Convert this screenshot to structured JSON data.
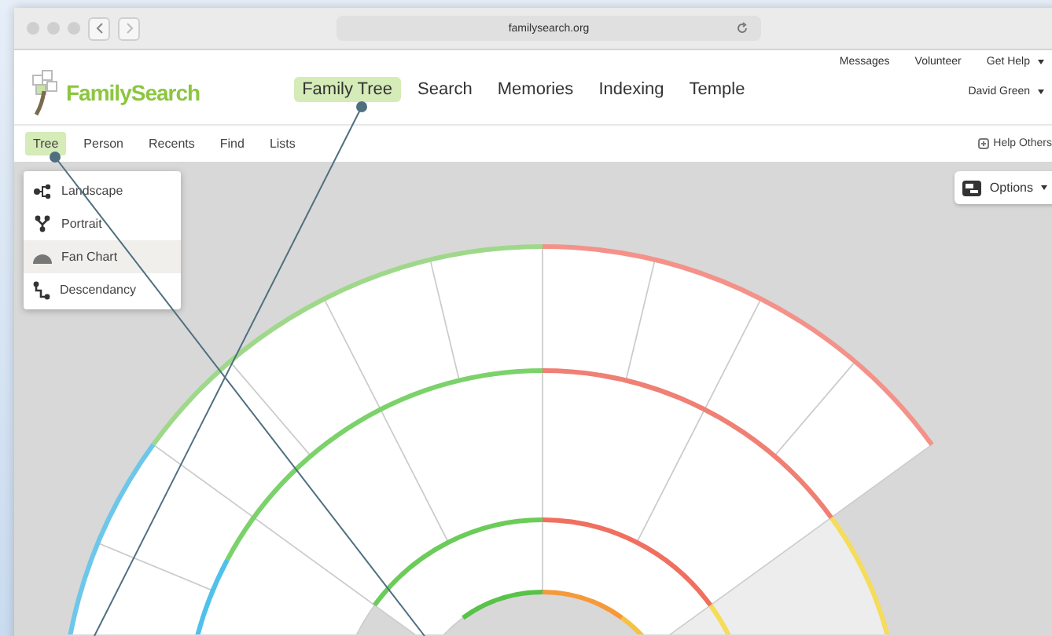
{
  "browser": {
    "address": "familysearch.org"
  },
  "header": {
    "logo": "FamilySearch",
    "top_links": [
      "Messages",
      "Volunteer",
      "Get Help"
    ],
    "user": "David Green",
    "nav": [
      {
        "label": "Family Tree",
        "selected": true
      },
      {
        "label": "Search",
        "selected": false
      },
      {
        "label": "Memories",
        "selected": false
      },
      {
        "label": "Indexing",
        "selected": false
      },
      {
        "label": "Temple",
        "selected": false
      }
    ]
  },
  "subnav": {
    "tabs": [
      {
        "label": "Tree",
        "selected": true
      },
      {
        "label": "Person",
        "selected": false
      },
      {
        "label": "Recents",
        "selected": false
      },
      {
        "label": "Find",
        "selected": false
      },
      {
        "label": "Lists",
        "selected": false
      }
    ],
    "help": "Help Others"
  },
  "view_menu": {
    "items": [
      {
        "label": "Landscape",
        "kind": "landscape",
        "selected": false
      },
      {
        "label": "Portrait",
        "kind": "portrait",
        "selected": false
      },
      {
        "label": "Fan Chart",
        "kind": "fan",
        "selected": true
      },
      {
        "label": "Descendancy",
        "kind": "descendancy",
        "selected": false
      }
    ]
  },
  "options": {
    "label": "Options"
  }
}
